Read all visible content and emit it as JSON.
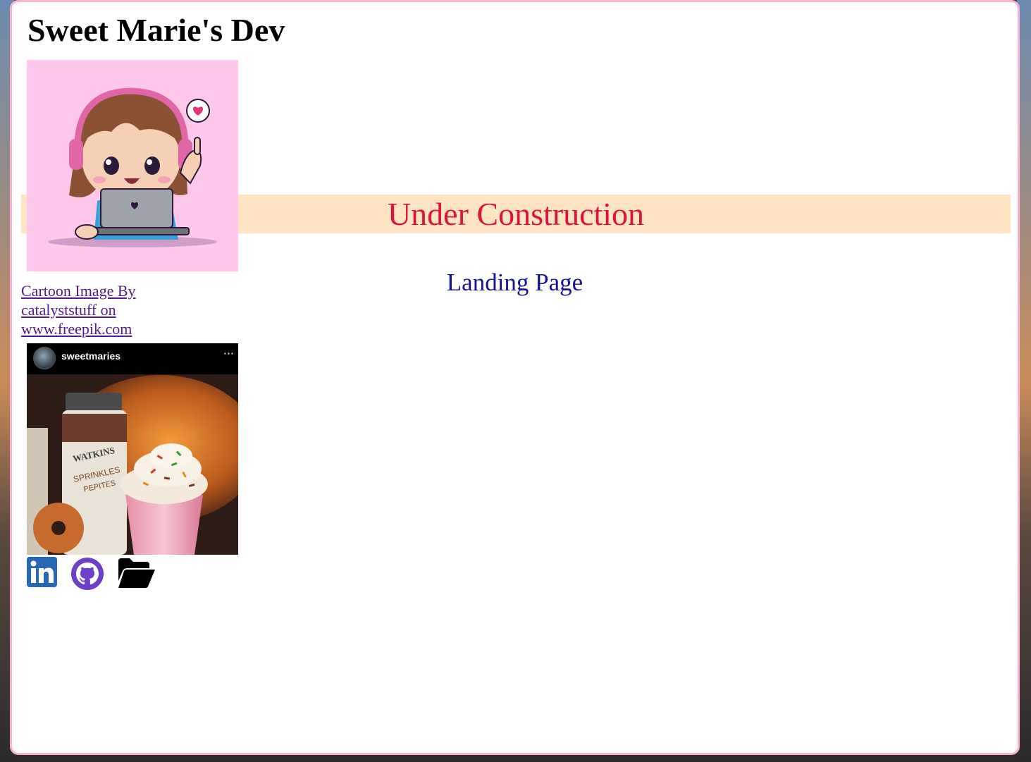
{
  "site": {
    "title": "Sweet Marie's Dev"
  },
  "banner": {
    "text": "Under Construction"
  },
  "main": {
    "subtitle": "Landing Page"
  },
  "credit": {
    "link_text": "Cartoon Image By catalyststuff on www.freepik.com"
  },
  "photo": {
    "username": "sweetmaries",
    "menu_glyph": "···",
    "jar_label_brand": "WATKINS",
    "jar_label_product": "SPRINKLES",
    "jar_label_sub": "PEPITES"
  },
  "social": {
    "icons": [
      "linkedin-icon",
      "github-icon",
      "folder-open-icon"
    ]
  },
  "colors": {
    "card_border": "#f7b3cf",
    "banner_bg": "#ffe4c4",
    "banner_text": "#dc143c",
    "subtitle": "#14149a",
    "link_visited": "#551a8b",
    "avatar_bg": "#fec8ec",
    "linkedin": "#2867b2",
    "github": "#6e40c9"
  }
}
